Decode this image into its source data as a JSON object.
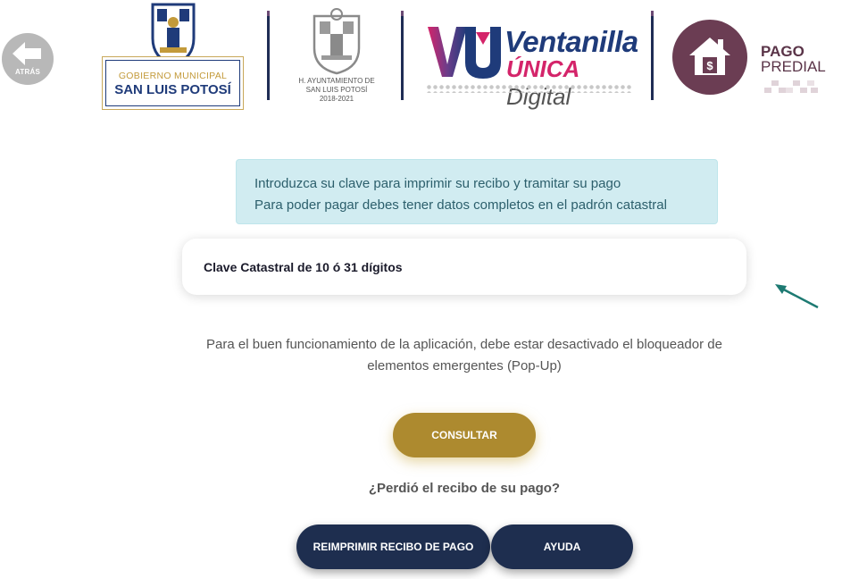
{
  "header": {
    "back_label": "ATRÁS",
    "gobierno_line1": "GOBIERNO MUNICIPAL",
    "gobierno_line2": "SAN LUIS POTOSÍ",
    "ayuntamiento_line1": "H. AYUNTAMIENTO DE",
    "ayuntamiento_line2": "SAN LUIS POTOSÍ",
    "ayuntamiento_line3": "2018-2021",
    "ventanilla_title1": "Ventanilla",
    "ventanilla_unica": "ÚNICA",
    "ventanilla_digital": "Digital",
    "pago_line1": "PAGO",
    "pago_line2": "PREDIAL"
  },
  "alert": {
    "line1": "Introduzca su clave para imprimir su recibo y tramitar su pago",
    "line2": "Para poder pagar debes tener datos completos en el padrón catastral"
  },
  "clave_input": {
    "placeholder": "Clave Catastral de 10 ó 31 dígitos",
    "value": ""
  },
  "popup_note": "Para el buen funcionamiento de la aplicación, debe estar desactivado el bloqueador de elementos emergentes (Pop-Up)",
  "buttons": {
    "consultar": "CONSULTAR",
    "reimprimir": "REIMPRIMIR RECIBO DE PAGO",
    "ayuda": "AYUDA"
  },
  "lost_question": "¿Perdió el recibo de su pago?",
  "colors": {
    "gold": "#ad8a2f",
    "navy": "#1e2e4f",
    "alert_bg": "#d1ecf1",
    "predial_purple": "#6b3d53"
  }
}
